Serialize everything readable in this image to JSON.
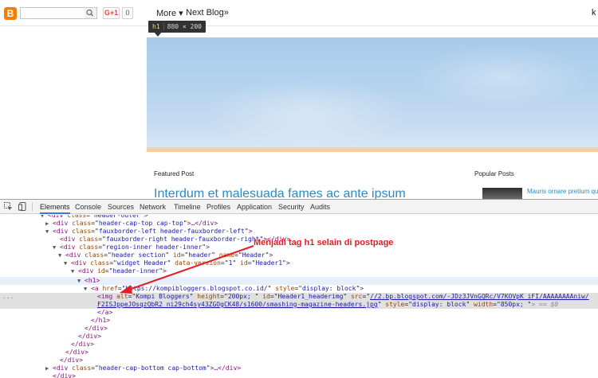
{
  "navbar": {
    "logo_glyph": "B",
    "search_placeholder": "",
    "gplus_label": "G+1",
    "gplus_count": "0",
    "more_label": "More",
    "more_arrow": "▾",
    "next_blog_label": "Next Blog»",
    "user_label": "k"
  },
  "tooltip": {
    "tag": "h1",
    "dimensions": "880 × 200"
  },
  "page": {
    "featured_label": "Featured Post",
    "featured_title": "Interdum et malesuada fames ac ante ipsum",
    "popular_label": "Popular Posts",
    "popular_item_title": "Mauris ornare pretium quam, faucibus pharetra"
  },
  "devtools": {
    "tabs": [
      "Elements",
      "Console",
      "Sources",
      "Network",
      "Timeline",
      "Profiles",
      "Application",
      "Security",
      "Audits"
    ],
    "active_tab": "Elements",
    "accent_color": "#3879d9",
    "ellipsis": "...",
    "tree": {
      "l0": {
        "tag": "div",
        "attrs": [
          {
            "n": "class",
            "v": "header-outer"
          }
        ],
        "suffix": ""
      },
      "l1": {
        "tag": "div",
        "attrs": [
          {
            "n": "class",
            "v": "header-cap-top cap-top"
          }
        ],
        "suffix": "…</div>"
      },
      "l2": {
        "tag": "div",
        "attrs": [
          {
            "n": "class",
            "v": "fauxborder-left header-fauxborder-left"
          }
        ],
        "suffix": ""
      },
      "l3": {
        "tag": "div",
        "attrs": [
          {
            "n": "class",
            "v": "fauxborder-right header-fauxborder-right"
          }
        ],
        "suffix": "</div>"
      },
      "l4": {
        "tag": "div",
        "attrs": [
          {
            "n": "class",
            "v": "region-inner header-inner"
          }
        ],
        "suffix": ""
      },
      "l5": {
        "tag": "div",
        "attrs": [
          {
            "n": "class",
            "v": "header section"
          },
          {
            "n": "id",
            "v": "header"
          },
          {
            "n": "name",
            "v": "Header"
          }
        ],
        "suffix": ""
      },
      "l6": {
        "tag": "div",
        "attrs": [
          {
            "n": "class",
            "v": "widget Header"
          },
          {
            "n": "data-version",
            "v": "1"
          },
          {
            "n": "id",
            "v": "Header1"
          }
        ],
        "suffix": ""
      },
      "l7": {
        "tag": "div",
        "attrs": [
          {
            "n": "id",
            "v": "header-inner"
          }
        ],
        "suffix": ""
      },
      "l8": {
        "tag": "h1",
        "attrs": [],
        "suffix": ""
      },
      "l9": {
        "tag": "a",
        "attrs": [
          {
            "n": "href",
            "v": "https://kompibloggers.blogspot.co.id/"
          },
          {
            "n": "style",
            "v": "display: block"
          }
        ],
        "suffix": ""
      },
      "l10": {
        "tag": "img",
        "attrs": [
          {
            "n": "alt",
            "v": "Kompi Bloggers"
          },
          {
            "n": "height",
            "v": "200px; "
          },
          {
            "n": "id",
            "v": "Header1_headerimg"
          }
        ],
        "src_attr": "src",
        "src": "//2.bp.blogspot.com/-JDz3JVnGQRc/V7KOVpK_iFI/AAAAAAAAniw/"
      },
      "l11": {
        "src_cont": "F2ISJppeJOsqzQbR2_ni29ch4sy43ZGOgCK48/s1600/smashing-magazine-headers.jpg",
        "attrs": [
          {
            "n": "style",
            "v": "display: block"
          },
          {
            "n": "width",
            "v": "850px; "
          }
        ],
        "suffix": "> == $0"
      },
      "close_a": "</a>",
      "close_h1": "</h1>",
      "close_div": "</div>",
      "l18": {
        "tag": "div",
        "attrs": [
          {
            "n": "class",
            "v": "header-cap-bottom cap-bottom"
          }
        ],
        "suffix": "…</div>"
      }
    }
  },
  "annotation": {
    "text": "Menjadi tag h1 selain di postpage",
    "color": "#e51c23"
  }
}
